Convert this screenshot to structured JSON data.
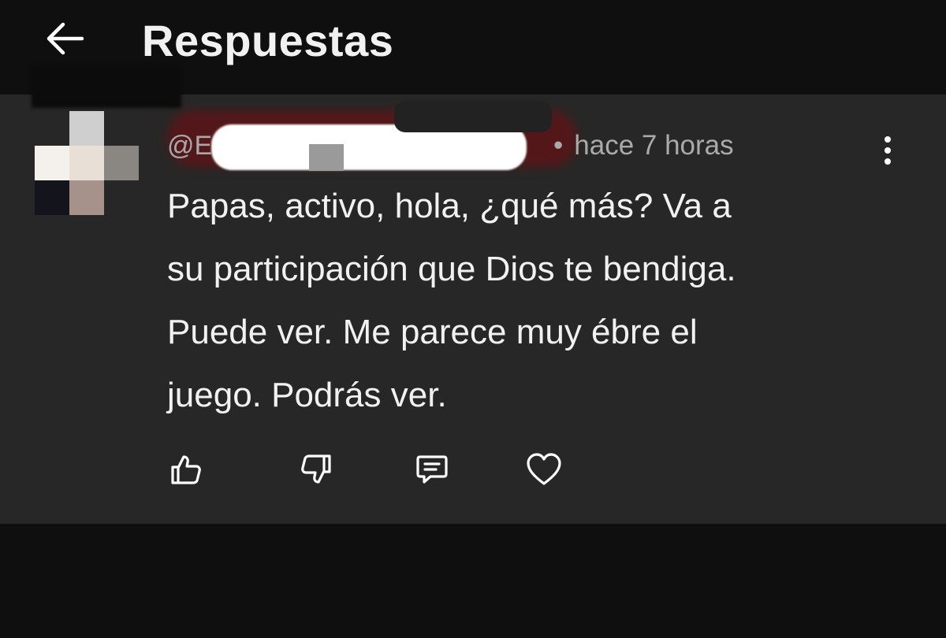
{
  "header": {
    "title": "Respuestas",
    "back_icon": "arrow-left-icon"
  },
  "comment": {
    "handle": "@E",
    "separator": "•",
    "timestamp": "hace 7 horas",
    "text_lines": [
      "Papas, activo, hola, ¿qué más? Va a",
      "su participación que Dios te bendiga.",
      "Puede ver. Me parece muy ébre el",
      "juego. Podrás ver."
    ],
    "more_icon": "more-vertical-icon"
  },
  "actions": {
    "icons": [
      "thumb-up-icon",
      "thumb-down-icon",
      "reply-comment-icon",
      "heart-icon"
    ]
  },
  "colors": {
    "background": "#0f0f0f",
    "panel": "#272727",
    "text": "#f1f1f1",
    "muted": "#aaaaaa"
  }
}
